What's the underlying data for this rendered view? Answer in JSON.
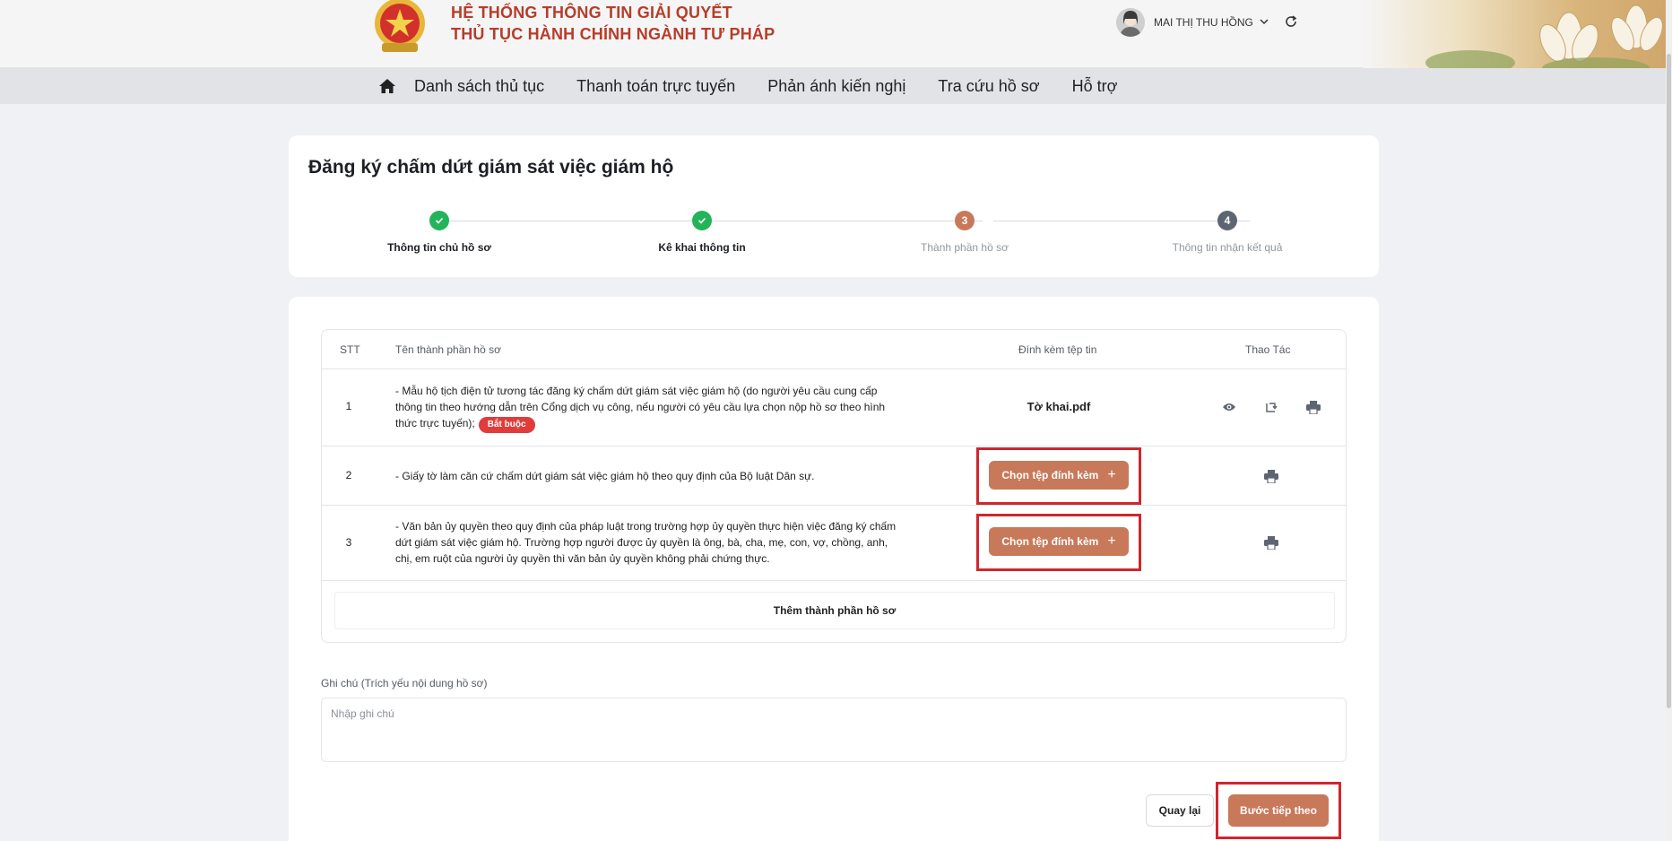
{
  "header": {
    "brand_line1": "HỆ THỐNG THÔNG TIN GIẢI QUYẾT",
    "brand_line2": "THỦ TỤC HÀNH CHÍNH NGÀNH TƯ PHÁP",
    "user_name": "MAI THỊ THU HỒNG"
  },
  "nav": {
    "items": [
      "Danh sách thủ tục",
      "Thanh toán trực tuyến",
      "Phản ánh kiến nghị",
      "Tra cứu hồ sơ",
      "Hỗ trợ"
    ]
  },
  "page": {
    "title": "Đăng ký chấm dứt giám sát việc giám hộ"
  },
  "steps": [
    {
      "number": "1",
      "label": "Thông tin chủ hồ sơ",
      "state": "done"
    },
    {
      "number": "2",
      "label": "Kê khai thông tin",
      "state": "done"
    },
    {
      "number": "3",
      "label": "Thành phần hồ sơ",
      "state": "current"
    },
    {
      "number": "4",
      "label": "Thông tin nhận kết quả",
      "state": "todo"
    }
  ],
  "table": {
    "headers": {
      "stt": "STT",
      "name": "Tên thành phần hồ sơ",
      "attach": "Đính kèm tệp tin",
      "actions": "Thao Tác"
    },
    "rows": [
      {
        "stt": "1",
        "lines": [
          "- Mẫu hộ tịch điện tử tương tác đăng ký chấm dứt giám sát việc giám hộ (do người yêu cầu cung cấp",
          "thông tin theo hướng dẫn trên Cổng dịch vụ công, nếu người có yêu cầu lựa chọn nộp hồ sơ theo hình",
          "thức trực tuyến);"
        ],
        "badge": "Bắt buộc",
        "file": "Tờ khai.pdf"
      },
      {
        "stt": "2",
        "lines": [
          "- Giấy tờ làm căn cứ chấm dứt giám sát việc giám hộ theo quy định của Bộ luật Dân sự."
        ],
        "attach_label": "Chọn tệp đính kèm"
      },
      {
        "stt": "3",
        "lines": [
          "- Văn bản ủy quyền theo quy định của pháp luật trong trường hợp ủy quyền thực hiện việc đăng ký chấm",
          "dứt giám sát việc giám hộ. Trường hợp người được ủy quyền là ông, bà, cha, mẹ, con, vợ, chồng, anh,",
          "chị, em ruột của người ủy quyền thì văn bản ủy quyền không phải chứng thực."
        ],
        "attach_label": "Chọn tệp đính kèm"
      }
    ],
    "add_label": "Thêm thành phần hồ sơ"
  },
  "note": {
    "label": "Ghi chú (Trích yếu nội dung hồ sơ)",
    "placeholder": "Nhập ghi chú",
    "value": ""
  },
  "buttons": {
    "back": "Quay lại",
    "next": "Bước tiếp theo"
  },
  "colors": {
    "brand_red": "#b73d2a",
    "accent": "#c8795a",
    "done_green": "#23b45a",
    "required_red": "#e23b3b",
    "highlight_red": "#d0262d"
  }
}
